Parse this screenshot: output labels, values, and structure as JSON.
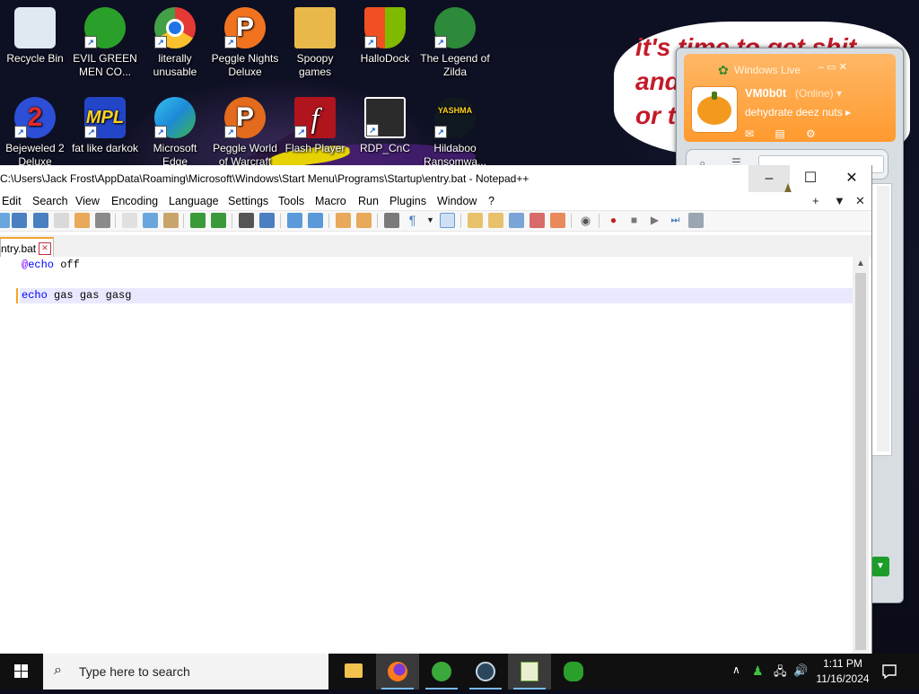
{
  "wallpaper": {
    "speech_text": "it's time to get shit\nand\nor t"
  },
  "desktop_icons": [
    {
      "label": "Recycle Bin",
      "icon": "recycle-bin-icon",
      "color": "#dfe9f2"
    },
    {
      "label": "EVIL GREEN MEN CO...",
      "icon": "green-men-icon",
      "color": "#2aa02a"
    },
    {
      "label": "literally unusable",
      "icon": "chrome-icon",
      "color": "#e53935"
    },
    {
      "label": "Peggle Nights Deluxe",
      "icon": "peggle-icon",
      "color": "#f2731f"
    },
    {
      "label": "Spoopy games",
      "icon": "folder-icon",
      "color": "#e8b84a"
    },
    {
      "label": "HalloDock",
      "icon": "windows-shield-icon",
      "color": "#f25022"
    },
    {
      "label": "The Legend of Zilda",
      "icon": "zilda-icon",
      "color": "#2c8a3a"
    },
    {
      "label": "Bejeweled 2 Deluxe",
      "icon": "bejeweled-icon",
      "color": "#2d4fd8"
    },
    {
      "label": "fat like darkok",
      "icon": "mpl-icon",
      "color": "#2346c9"
    },
    {
      "label": "Microsoft Edge",
      "icon": "edge-icon",
      "color": "#1c8ad6"
    },
    {
      "label": "Peggle World of Warcraft",
      "icon": "peggle-wow-icon",
      "color": "#e46b1d"
    },
    {
      "label": "Flash Player",
      "icon": "flash-icon",
      "color": "#b0141c"
    },
    {
      "label": "RDP_CnC",
      "icon": "rdp-icon",
      "color": "#2b2b2b"
    },
    {
      "label": "Hildaboo Ransomwa...",
      "icon": "yashma-icon",
      "color": "#101820"
    }
  ],
  "wlm": {
    "title": "Windows Live",
    "name": "VM0b0t",
    "status": "(Online) ▾",
    "message": "dehydrate deez nuts ▸",
    "controls": "– ▭ ✕"
  },
  "npp": {
    "title": "C:\\Users\\Jack Frost\\AppData\\Roaming\\Microsoft\\Windows\\Start Menu\\Programs\\Startup\\entry.bat - Notepad++",
    "menu": [
      "Edit",
      "Search",
      "View",
      "Encoding",
      "Language",
      "Settings",
      "Tools",
      "Macro",
      "Run",
      "Plugins",
      "Window",
      "?"
    ],
    "menu_right": [
      "+",
      "▼",
      "✕"
    ],
    "tab_label": "ntry.bat",
    "lines": [
      {
        "prefix": "@",
        "keyword": "echo",
        "rest": " off"
      },
      {
        "prefix": "",
        "keyword": "",
        "rest": ""
      },
      {
        "prefix": "",
        "keyword": "echo",
        "rest": " gas gas gasg"
      }
    ]
  },
  "taskbar": {
    "search_placeholder": "Type here to search",
    "time": "1:11 PM",
    "date": "11/16/2024",
    "apps": [
      "file-explorer-icon",
      "firefox-icon",
      "windows-live-messenger-icon",
      "steam-icon",
      "notepad-plus-plus-icon",
      "green-men-icon"
    ]
  },
  "colors": {
    "accent_orange": "#ff9a2e",
    "npp_tab_accent": "#f3a52b",
    "keyword_blue": "#0000ff",
    "taskbar": "#101010"
  }
}
